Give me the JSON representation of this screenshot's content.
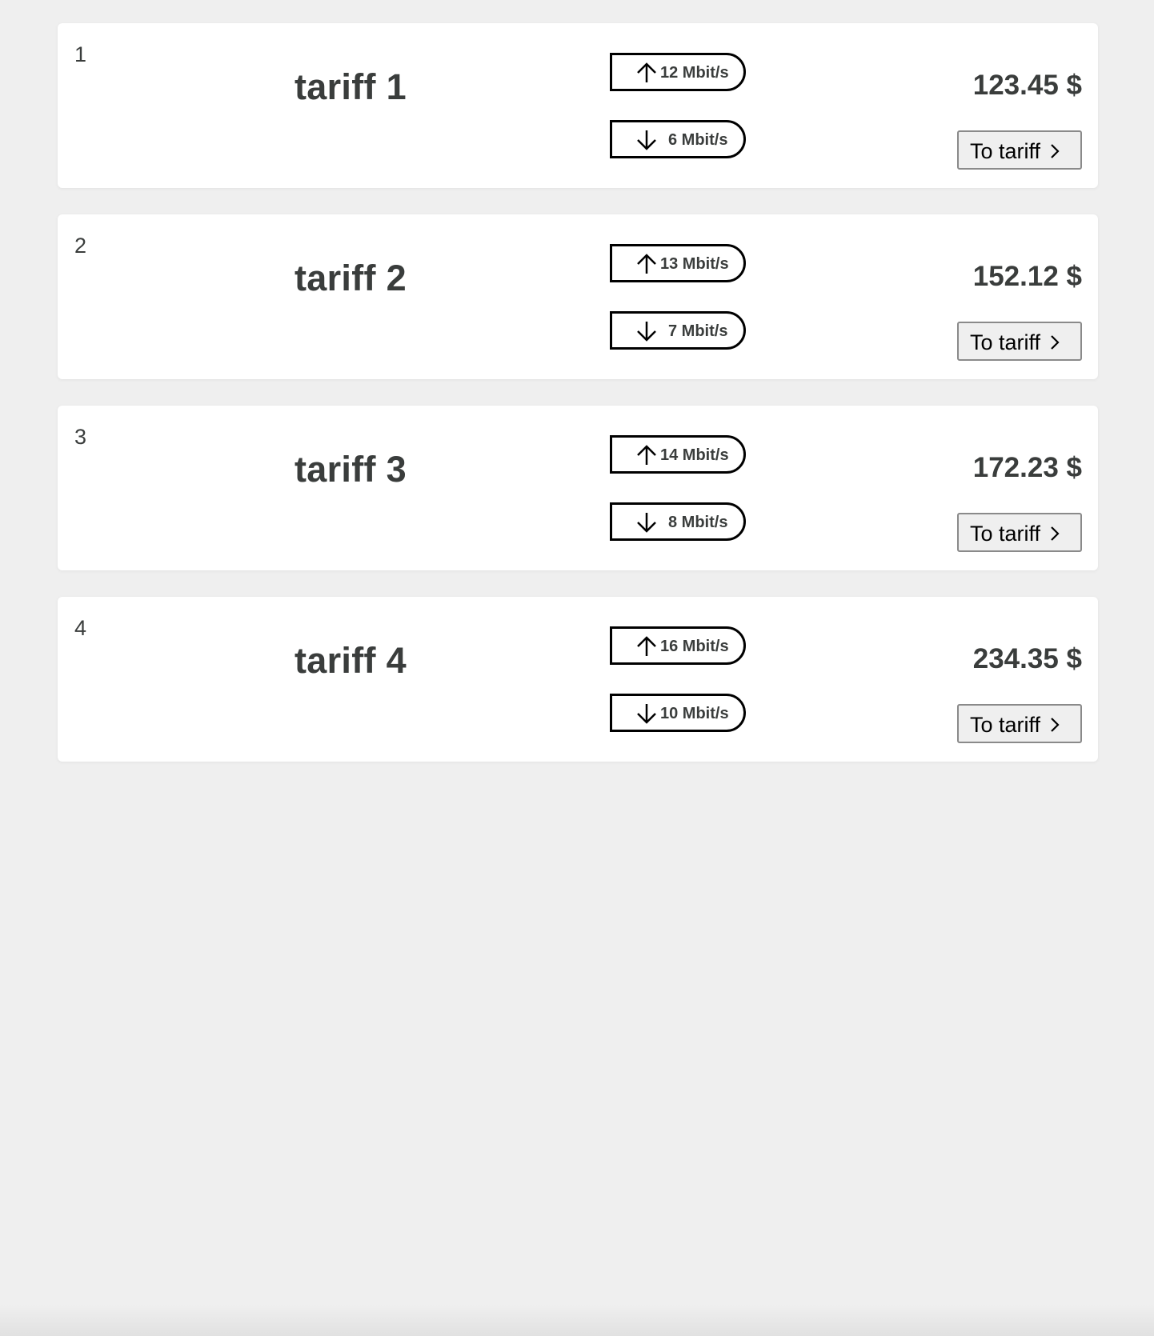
{
  "tariffs": [
    {
      "number": "1",
      "name": "tariff 1",
      "upload": "12 Mbit/s",
      "download": "6 Mbit/s",
      "price": "123.45 $",
      "button_label": "To tariff"
    },
    {
      "number": "2",
      "name": "tariff 2",
      "upload": "13 Mbit/s",
      "download": "7 Mbit/s",
      "price": "152.12 $",
      "button_label": "To tariff"
    },
    {
      "number": "3",
      "name": "tariff 3",
      "upload": "14 Mbit/s",
      "download": "8 Mbit/s",
      "price": "172.23 $",
      "button_label": "To tariff"
    },
    {
      "number": "4",
      "name": "tariff 4",
      "upload": "16 Mbit/s",
      "download": "10 Mbit/s",
      "price": "234.35 $",
      "button_label": "To tariff"
    }
  ],
  "icons": {
    "upload": "arrow-up-icon",
    "download": "arrow-down-icon",
    "button": "chevron-right-icon"
  },
  "colors": {
    "background": "#efefef",
    "card": "#ffffff",
    "text": "#3a3d3c"
  }
}
